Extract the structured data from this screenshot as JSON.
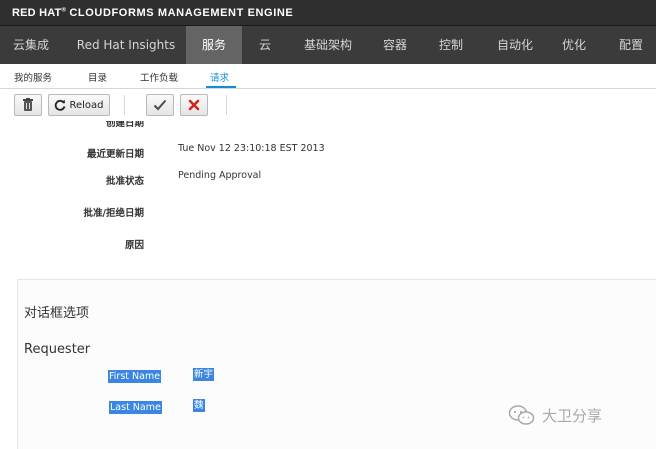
{
  "brand": {
    "red_hat": "RED HAT",
    "reg": "®",
    "rest": "CLOUDFORMS MANAGEMENT ENGINE"
  },
  "main_nav": [
    {
      "label": "云集成"
    },
    {
      "label": "Red Hat Insights"
    },
    {
      "label": "服务",
      "active": true
    },
    {
      "label": "云"
    },
    {
      "label": "基础架构"
    },
    {
      "label": "容器"
    },
    {
      "label": "控制"
    },
    {
      "label": "自动化"
    },
    {
      "label": "优化"
    },
    {
      "label": "配置"
    }
  ],
  "sub_nav": [
    {
      "label": "我的服务"
    },
    {
      "label": "目录"
    },
    {
      "label": "工作负载"
    },
    {
      "label": "请求",
      "active": true
    }
  ],
  "toolbar": {
    "reload_label": "Reload"
  },
  "details": {
    "cut_label": "创建日期",
    "fields": [
      {
        "label": "最近更新日期",
        "value": "Tue Nov 12 23:10:18 EST 2013"
      },
      {
        "label": "批准状态",
        "value": "Pending Approval"
      },
      {
        "label": "批准/拒绝日期",
        "value": ""
      },
      {
        "label": "原因",
        "value": ""
      }
    ]
  },
  "dialog": {
    "title": "对话框选项",
    "group": "Requester",
    "fields": [
      {
        "label": "First Name",
        "value": "新宇"
      },
      {
        "label": "Last Name",
        "value": "魏"
      }
    ]
  },
  "watermark": {
    "text": "大卫分享"
  },
  "colors": {
    "brand_bg": "#2f2f2f",
    "nav_bg": "#3b3b3b",
    "nav_active": "#646464",
    "accent": "#0f8fd6",
    "highlight": "#3a86e0",
    "reject": "#d0261c"
  }
}
